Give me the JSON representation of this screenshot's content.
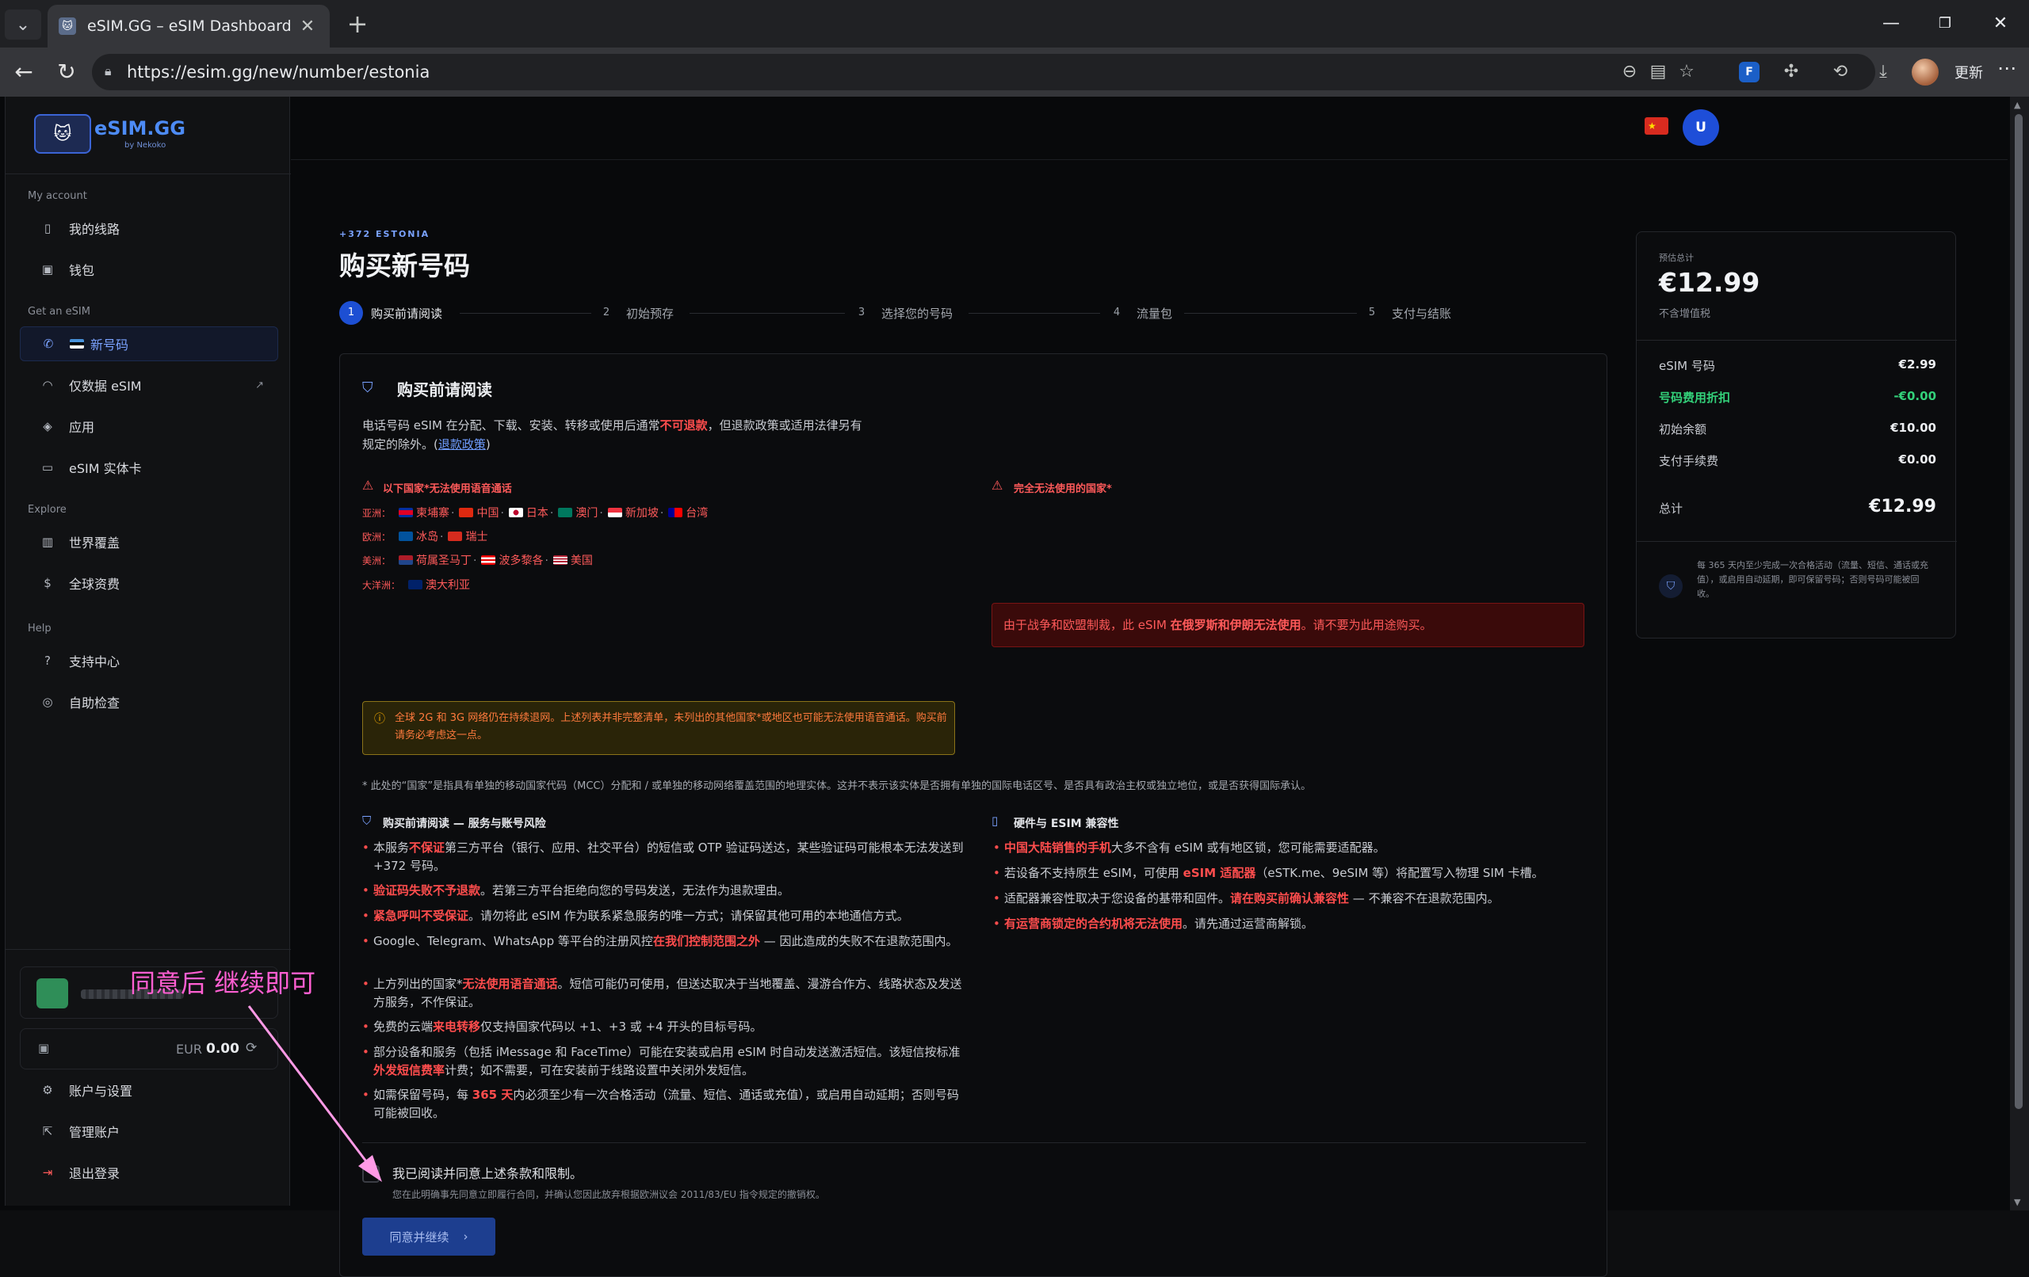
{
  "browser": {
    "tab_title": "eSIM.GG – eSIM Dashboard",
    "url": "https://esim.gg/new/number/estonia",
    "update_label": "更新"
  },
  "sidebar": {
    "logo_name": "eSIM.GG",
    "logo_sub": "by Nekoko",
    "sections": [
      {
        "label": "My account",
        "items": [
          {
            "label": "我的线路",
            "icon": "phone-icon"
          },
          {
            "label": "钱包",
            "icon": "wallet-icon"
          }
        ]
      },
      {
        "label": "Get an eSIM",
        "items": [
          {
            "label": "新号码",
            "icon": "phone-call-icon"
          },
          {
            "label": "仅数据 eSIM",
            "icon": "wifi-icon"
          },
          {
            "label": "应用",
            "icon": "box-icon"
          },
          {
            "label": "eSIM 实体卡",
            "icon": "card-icon"
          }
        ]
      },
      {
        "label": "Explore",
        "items": [
          {
            "label": "世界覆盖",
            "icon": "map-icon"
          },
          {
            "label": "全球资费",
            "icon": "dollar-icon"
          }
        ]
      },
      {
        "label": "Help",
        "items": [
          {
            "label": "支持中心",
            "icon": "help-icon"
          },
          {
            "label": "自助检查",
            "icon": "lifebuoy-icon"
          }
        ]
      }
    ],
    "balance_currency": "EUR",
    "balance_value": "0.00",
    "bottom_items": [
      {
        "label": "账户与设置",
        "icon": "gear-icon"
      },
      {
        "label": "管理账户",
        "icon": "external-link-icon"
      },
      {
        "label": "退出登录",
        "icon": "logout-icon"
      }
    ]
  },
  "topbar": {
    "avatar_letter": "U"
  },
  "header": {
    "eyebrow": "+372 ESTONIA",
    "title": "购买新号码",
    "steps": [
      {
        "num": "1",
        "label": "购买前请阅读"
      },
      {
        "num": "2",
        "label": "初始预存"
      },
      {
        "num": "3",
        "label": "选择您的号码"
      },
      {
        "num": "4",
        "label": "流量包"
      },
      {
        "num": "5",
        "label": "支付与结账"
      }
    ]
  },
  "panel": {
    "title": "购买前请阅读",
    "intro_1": "电话号码 eSIM 在分配、下载、安装、转移或使用后通常",
    "intro_red": "不可退款",
    "intro_2": "，但退款政策或适用法律另有",
    "intro_3": "规定的除外。(",
    "intro_link": "退款政策",
    "intro_4": ")",
    "voice_head": "以下国家*无法使用语音通话",
    "regions": [
      {
        "region": "亚洲：",
        "countries": [
          "柬埔寨",
          "中国",
          "日本",
          "澳门",
          "新加坡",
          "台湾"
        ]
      },
      {
        "region": "欧洲：",
        "countries": [
          "冰岛",
          "瑞士"
        ]
      },
      {
        "region": "美洲：",
        "countries": [
          "荷属圣马丁",
          "波多黎各",
          "美国"
        ]
      },
      {
        "region": "大洋洲：",
        "countries": [
          "澳大利亚"
        ]
      }
    ],
    "yellow_note": "全球 2G 和 3G 网络仍在持续退网。上述列表并非完整清单，未列出的其他国家*或地区也可能无法使用语音通话。购买前请务必考虑这一点。",
    "blocked_head": "完全无法使用的国家*",
    "blocked_1": "由于战争和欧盟制裁，此 eSIM ",
    "blocked_bold": "在俄罗斯和伊朗无法使用",
    "blocked_2": "。请不要为此用途购买。",
    "footnote": "* 此处的“国家”是指具有单独的移动国家代码（MCC）分配和 / 或单独的移动网络覆盖范围的地理实体。这并不表示该实体是否拥有单独的国际电话区号、是否具有政治主权或独立地位，或是否获得国际承认。",
    "left_head": "购买前请阅读 — 服务与账号风险",
    "left_bullets": [
      [
        "本服务",
        "不保证",
        "第三方平台（银行、应用、社交平台）的短信或 OTP 验证码送达，某些验证码可能根本无法发送到 +372 号码。"
      ],
      [
        "",
        "验证码失败不予退款",
        "。若第三方平台拒绝向您的号码发送，无法作为退款理由。"
      ],
      [
        "",
        "紧急呼叫不受保证",
        "。请勿将此 eSIM 作为联系紧急服务的唯一方式；请保留其他可用的本地通信方式。"
      ],
      [
        "Google、Telegram、WhatsApp 等平台的注册风控",
        "在我们控制范围之外",
        " — 因此造成的失败不在退款范围内。"
      ],
      [
        "上方列出的国家*",
        "无法使用语音通话",
        "。短信可能仍可使用，但送达取决于当地覆盖、漫游合作方、线路状态及发送方服务，不作保证。"
      ],
      [
        "免费的云端",
        "来电转移",
        "仅支持国家代码以 +1、+3 或 +4 开头的目标号码。"
      ],
      [
        "部分设备和服务（包括 iMessage 和 FaceTime）可能在安装或启用 eSIM 时自动发送激活短信。该短信按标准",
        "外发短信费率",
        "计费；如不需要，可在安装前于线路设置中关闭外发短信。"
      ],
      [
        "如需保留号码，每 ",
        "365 天",
        "内必须至少有一次合格活动（流量、短信、通话或充值），或启用自动延期；否则号码可能被回收。"
      ]
    ],
    "right_head": "硬件与 ESIM 兼容性",
    "right_bullets": [
      [
        "",
        "中国大陆销售的手机",
        "大多不含有 eSIM 或有地区锁，您可能需要适配器。"
      ],
      [
        "若设备不支持原生 eSIM，可使用 ",
        "eSIM 适配器",
        "（eSTK.me、9eSIM 等）将配置写入物理 SIM 卡槽。"
      ],
      [
        "适配器兼容性取决于您设备的基带和固件。",
        "请在购买前确认兼容性",
        " — 不兼容不在退款范围内。"
      ],
      [
        "",
        "有运营商锁定的合约机将无法使用",
        "。请先通过运营商解锁。"
      ]
    ],
    "agree_label": "我已阅读并同意上述条款和限制。",
    "agree_note": "您在此明确事先同意立即履行合同，并确认您因此放弃根据欧洲议会 2011/83/EU 指令规定的撤销权。",
    "continue_label": "同意并继续",
    "agree_checked": false
  },
  "summary": {
    "label": "预估总计",
    "total": "€12.99",
    "vat": "不含增值税",
    "rows": [
      {
        "label": "eSIM 号码",
        "value": "€2.99"
      },
      {
        "label": "号码费用折扣",
        "value": "-€0.00"
      },
      {
        "label": "初始余额",
        "value": "€10.00"
      },
      {
        "label": "支付手续费",
        "value": "€0.00"
      }
    ],
    "total_label": "总计",
    "total_value": "€12.99",
    "note": "每 365 天内至少完成一次合格活动（流量、短信、通话或充值），或启用自动延期，即可保留号码；否则号码可能被回收。"
  },
  "annotation": {
    "text": "同意后 继续即可",
    "color": "#ff5fd2"
  }
}
